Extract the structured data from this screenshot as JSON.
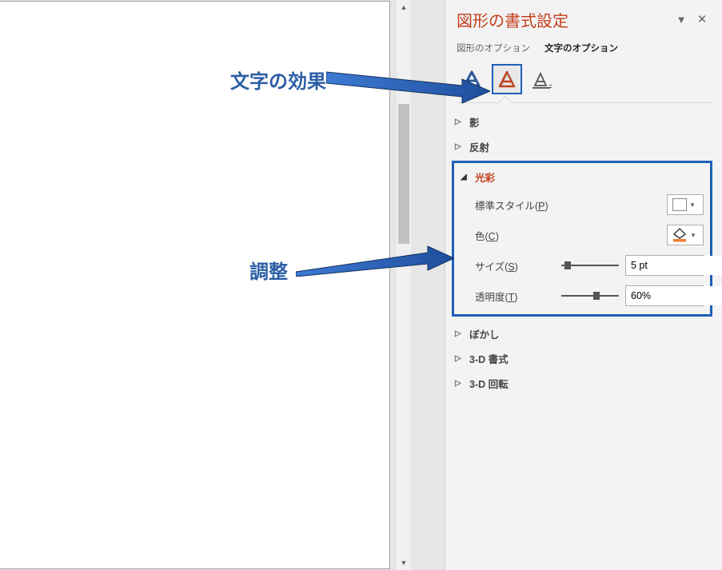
{
  "pane": {
    "title": "図形の書式設定",
    "tab_shape": "図形のオプション",
    "tab_text": "文字のオプション"
  },
  "sections": {
    "shadow": "影",
    "reflection": "反射",
    "glow": "光彩",
    "softedges": "ぼかし",
    "format3d": "3-D 書式",
    "rotate3d": "3-D 回転"
  },
  "glow": {
    "preset_label_pre": "標準スタイル(",
    "preset_key": "P",
    "preset_label_post": ")",
    "color_label_pre": "色(",
    "color_key": "C",
    "color_label_post": ")",
    "size_label_pre": "サイズ(",
    "size_key": "S",
    "size_label_post": ")",
    "size_value": "5 pt",
    "trans_label_pre": "透明度(",
    "trans_key": "T",
    "trans_label_post": ")",
    "trans_value": "60%"
  },
  "callouts": {
    "effects": "文字の効果",
    "adjust": "調整"
  }
}
